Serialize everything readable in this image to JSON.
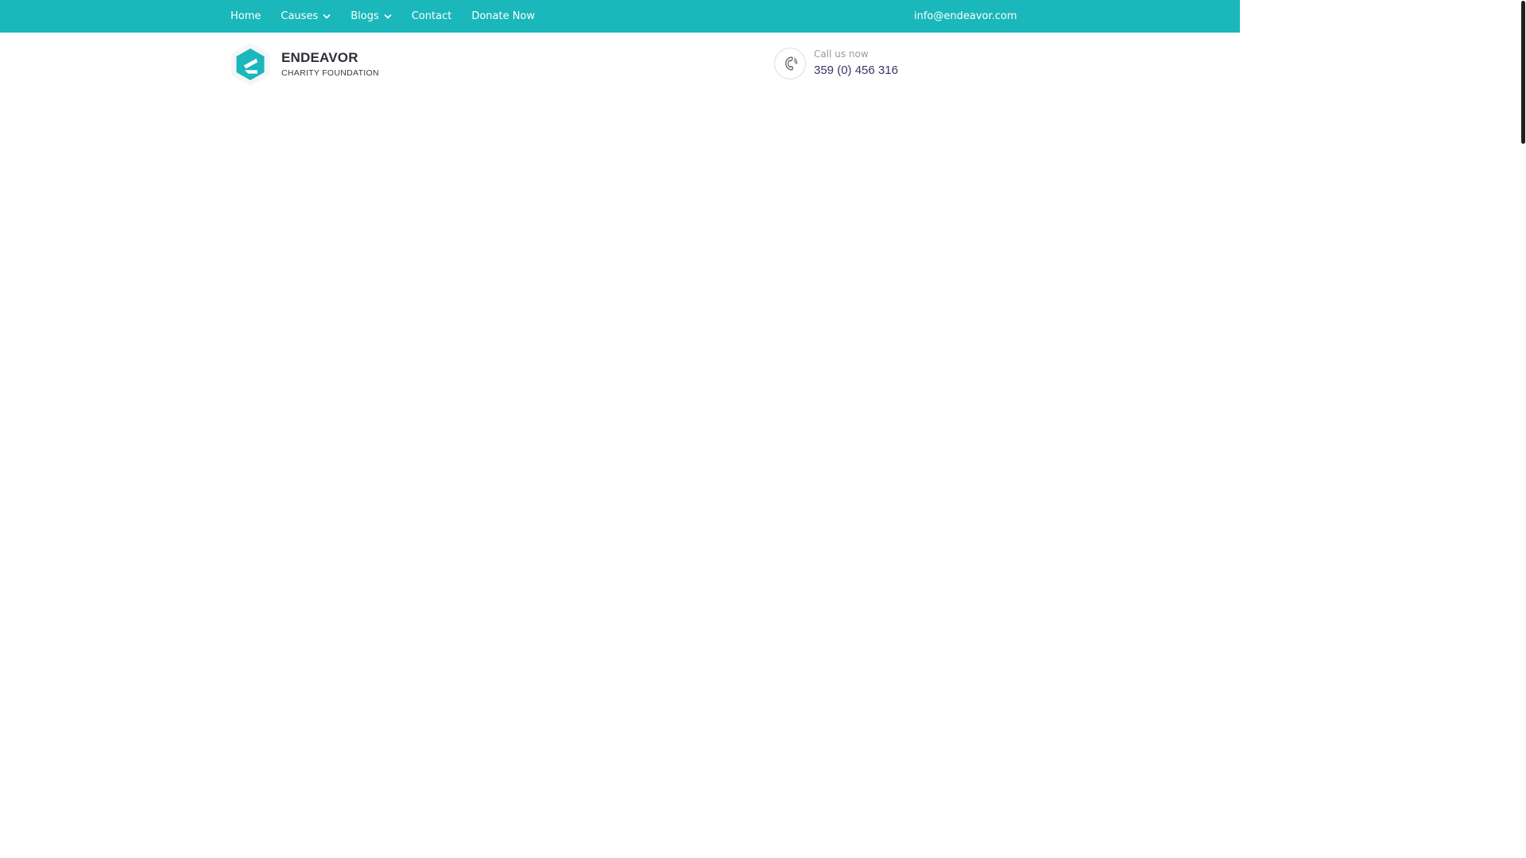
{
  "topbar": {
    "nav": [
      {
        "label": "Home",
        "dropdown": false
      },
      {
        "label": "Causes",
        "dropdown": true
      },
      {
        "label": "Blogs",
        "dropdown": true
      },
      {
        "label": "Contact",
        "dropdown": false
      },
      {
        "label": "Donate Now",
        "dropdown": false
      }
    ],
    "email": "info@endeavor.com"
  },
  "header": {
    "logo": {
      "name": "ENDEAVOR",
      "tagline": "CHARITY FOUNDATION",
      "icon": "endeavor-hexagon-logo"
    },
    "call": {
      "label": "Call us now",
      "number": "359 (0) 456 316",
      "icon": "phone-icon"
    }
  },
  "colors": {
    "topbar_bg": "#1ab7bb",
    "accent": "#1ab7bb",
    "heading": "#2e2e3a",
    "phone_number": "#3b3369",
    "muted": "#9a9a9a"
  }
}
